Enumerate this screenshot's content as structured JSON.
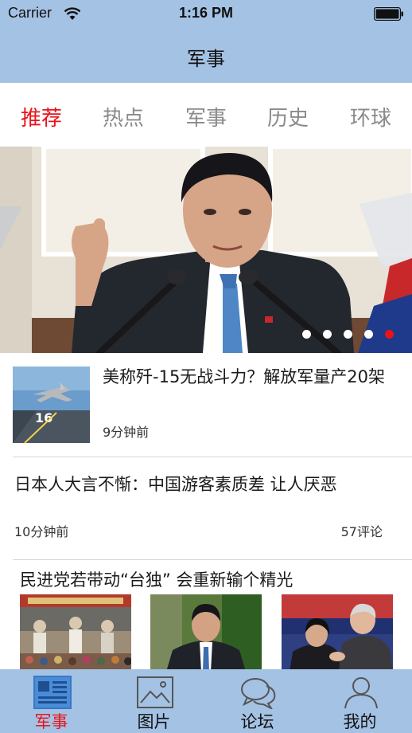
{
  "status_bar": {
    "carrier": "Carrier",
    "time": "1:16 PM",
    "wifi_icon": "wifi-icon",
    "battery_icon": "battery-icon"
  },
  "nav": {
    "title": "军事"
  },
  "tabs": [
    {
      "label": "推荐",
      "active": true
    },
    {
      "label": "热点",
      "active": false
    },
    {
      "label": "军事",
      "active": false
    },
    {
      "label": "历史",
      "active": false
    },
    {
      "label": "环球",
      "active": false
    }
  ],
  "banner": {
    "page_count": 5,
    "active_page": 4
  },
  "news": [
    {
      "title": "美称歼-15无战斗力？解放军量产20架",
      "time": "9分钟前"
    },
    {
      "title": "日本人大言不惭：中国游客素质差 让人厌恶",
      "time": "10分钟前",
      "comments": "57评论"
    },
    {
      "title": "民进党若带动“台独” 会重新输个精光"
    }
  ],
  "tabbar": [
    {
      "label": "军事",
      "icon": "news-icon",
      "active": true
    },
    {
      "label": "图片",
      "icon": "picture-icon",
      "active": false
    },
    {
      "label": "论坛",
      "icon": "chat-bubbles-icon",
      "active": false
    },
    {
      "label": "我的",
      "icon": "person-icon",
      "active": false
    }
  ],
  "colors": {
    "bar_blue": "#a4c2e4",
    "accent_red": "#e8141a",
    "tab_gray": "#8a8a8a"
  }
}
